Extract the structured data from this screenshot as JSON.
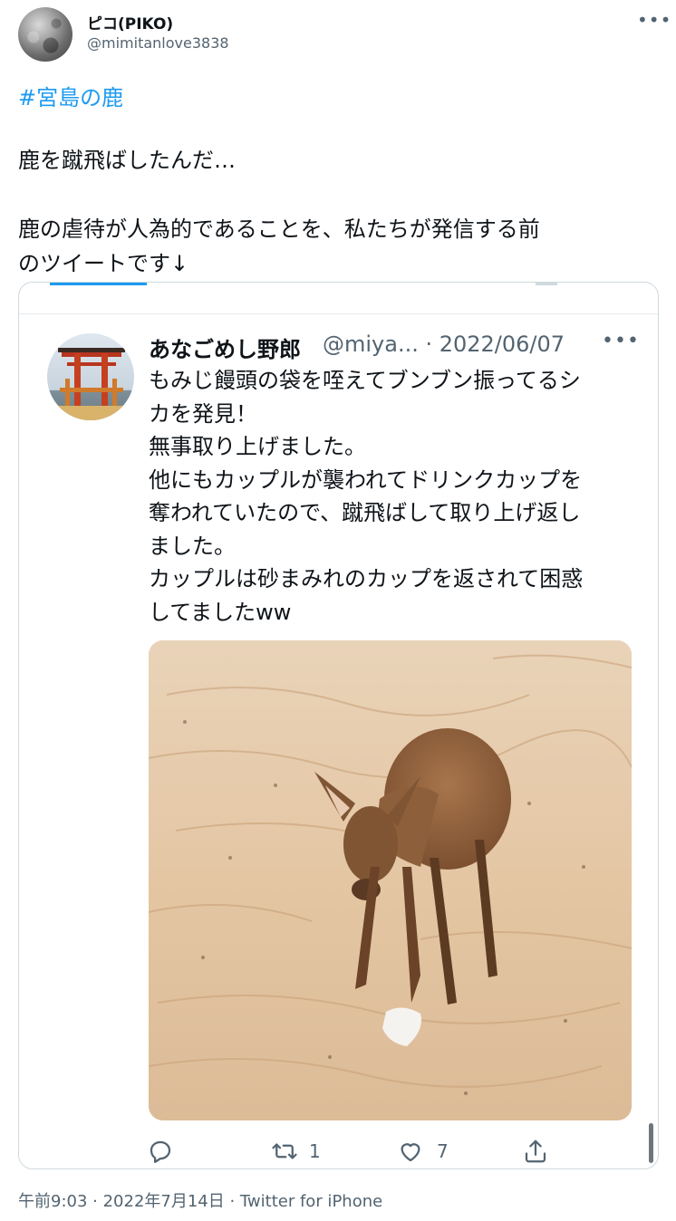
{
  "user": {
    "display_name": "ピコ(PIKO)",
    "handle": "@mimitanlove3838"
  },
  "tweet": {
    "hashtag": "#宮島の鹿",
    "body": "鹿を蹴飛ばしたんだ…\n\n鹿の虐待が人為的であることを、私たちが発信する前\nのツイートです↓"
  },
  "quoted": {
    "name": "あなごめし野郎",
    "handle_date": "@miya... · 2022/06/07",
    "body": "もみじ饅頭の袋を咥えてブンブン振ってるシ\nカを発見！\n無事取り上げました。\n他にもカップルが襲われてドリンクカップを\n奪われていたので、蹴飛ばして取り上げ返し\nました。\nカップルは砂まみれのカップを返されて困惑\nしてましたww",
    "retweet_count": "1",
    "like_count": "7"
  },
  "meta": {
    "text": "午前9:03 · 2022年7月14日 · Twitter for iPhone"
  },
  "icons": {
    "more": "more-horizontal-icon",
    "reply": "reply-icon",
    "retweet": "retweet-icon",
    "like": "heart-icon",
    "share": "share-icon"
  },
  "colors": {
    "link": "#1d9bf0",
    "secondary_text": "#536471",
    "border": "#cfd9de"
  }
}
